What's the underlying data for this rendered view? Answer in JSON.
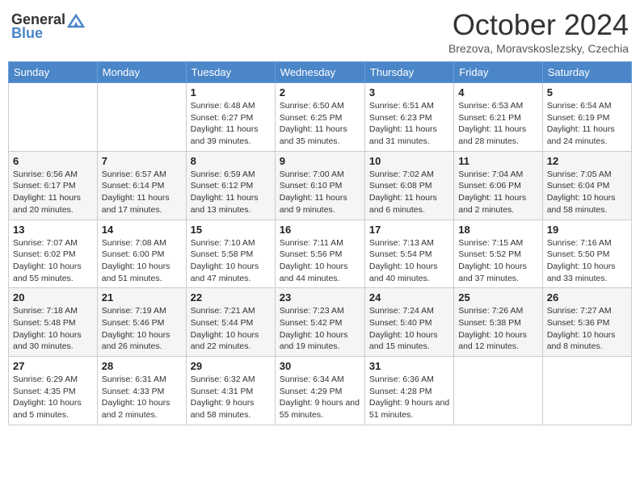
{
  "header": {
    "logo_general": "General",
    "logo_blue": "Blue",
    "month_title": "October 2024",
    "subtitle": "Brezova, Moravskoslezsky, Czechia"
  },
  "days_of_week": [
    "Sunday",
    "Monday",
    "Tuesday",
    "Wednesday",
    "Thursday",
    "Friday",
    "Saturday"
  ],
  "weeks": [
    [
      {
        "day": "",
        "sunrise": "",
        "sunset": "",
        "daylight": ""
      },
      {
        "day": "",
        "sunrise": "",
        "sunset": "",
        "daylight": ""
      },
      {
        "day": "1",
        "sunrise": "Sunrise: 6:48 AM",
        "sunset": "Sunset: 6:27 PM",
        "daylight": "Daylight: 11 hours and 39 minutes."
      },
      {
        "day": "2",
        "sunrise": "Sunrise: 6:50 AM",
        "sunset": "Sunset: 6:25 PM",
        "daylight": "Daylight: 11 hours and 35 minutes."
      },
      {
        "day": "3",
        "sunrise": "Sunrise: 6:51 AM",
        "sunset": "Sunset: 6:23 PM",
        "daylight": "Daylight: 11 hours and 31 minutes."
      },
      {
        "day": "4",
        "sunrise": "Sunrise: 6:53 AM",
        "sunset": "Sunset: 6:21 PM",
        "daylight": "Daylight: 11 hours and 28 minutes."
      },
      {
        "day": "5",
        "sunrise": "Sunrise: 6:54 AM",
        "sunset": "Sunset: 6:19 PM",
        "daylight": "Daylight: 11 hours and 24 minutes."
      }
    ],
    [
      {
        "day": "6",
        "sunrise": "Sunrise: 6:56 AM",
        "sunset": "Sunset: 6:17 PM",
        "daylight": "Daylight: 11 hours and 20 minutes."
      },
      {
        "day": "7",
        "sunrise": "Sunrise: 6:57 AM",
        "sunset": "Sunset: 6:14 PM",
        "daylight": "Daylight: 11 hours and 17 minutes."
      },
      {
        "day": "8",
        "sunrise": "Sunrise: 6:59 AM",
        "sunset": "Sunset: 6:12 PM",
        "daylight": "Daylight: 11 hours and 13 minutes."
      },
      {
        "day": "9",
        "sunrise": "Sunrise: 7:00 AM",
        "sunset": "Sunset: 6:10 PM",
        "daylight": "Daylight: 11 hours and 9 minutes."
      },
      {
        "day": "10",
        "sunrise": "Sunrise: 7:02 AM",
        "sunset": "Sunset: 6:08 PM",
        "daylight": "Daylight: 11 hours and 6 minutes."
      },
      {
        "day": "11",
        "sunrise": "Sunrise: 7:04 AM",
        "sunset": "Sunset: 6:06 PM",
        "daylight": "Daylight: 11 hours and 2 minutes."
      },
      {
        "day": "12",
        "sunrise": "Sunrise: 7:05 AM",
        "sunset": "Sunset: 6:04 PM",
        "daylight": "Daylight: 10 hours and 58 minutes."
      }
    ],
    [
      {
        "day": "13",
        "sunrise": "Sunrise: 7:07 AM",
        "sunset": "Sunset: 6:02 PM",
        "daylight": "Daylight: 10 hours and 55 minutes."
      },
      {
        "day": "14",
        "sunrise": "Sunrise: 7:08 AM",
        "sunset": "Sunset: 6:00 PM",
        "daylight": "Daylight: 10 hours and 51 minutes."
      },
      {
        "day": "15",
        "sunrise": "Sunrise: 7:10 AM",
        "sunset": "Sunset: 5:58 PM",
        "daylight": "Daylight: 10 hours and 47 minutes."
      },
      {
        "day": "16",
        "sunrise": "Sunrise: 7:11 AM",
        "sunset": "Sunset: 5:56 PM",
        "daylight": "Daylight: 10 hours and 44 minutes."
      },
      {
        "day": "17",
        "sunrise": "Sunrise: 7:13 AM",
        "sunset": "Sunset: 5:54 PM",
        "daylight": "Daylight: 10 hours and 40 minutes."
      },
      {
        "day": "18",
        "sunrise": "Sunrise: 7:15 AM",
        "sunset": "Sunset: 5:52 PM",
        "daylight": "Daylight: 10 hours and 37 minutes."
      },
      {
        "day": "19",
        "sunrise": "Sunrise: 7:16 AM",
        "sunset": "Sunset: 5:50 PM",
        "daylight": "Daylight: 10 hours and 33 minutes."
      }
    ],
    [
      {
        "day": "20",
        "sunrise": "Sunrise: 7:18 AM",
        "sunset": "Sunset: 5:48 PM",
        "daylight": "Daylight: 10 hours and 30 minutes."
      },
      {
        "day": "21",
        "sunrise": "Sunrise: 7:19 AM",
        "sunset": "Sunset: 5:46 PM",
        "daylight": "Daylight: 10 hours and 26 minutes."
      },
      {
        "day": "22",
        "sunrise": "Sunrise: 7:21 AM",
        "sunset": "Sunset: 5:44 PM",
        "daylight": "Daylight: 10 hours and 22 minutes."
      },
      {
        "day": "23",
        "sunrise": "Sunrise: 7:23 AM",
        "sunset": "Sunset: 5:42 PM",
        "daylight": "Daylight: 10 hours and 19 minutes."
      },
      {
        "day": "24",
        "sunrise": "Sunrise: 7:24 AM",
        "sunset": "Sunset: 5:40 PM",
        "daylight": "Daylight: 10 hours and 15 minutes."
      },
      {
        "day": "25",
        "sunrise": "Sunrise: 7:26 AM",
        "sunset": "Sunset: 5:38 PM",
        "daylight": "Daylight: 10 hours and 12 minutes."
      },
      {
        "day": "26",
        "sunrise": "Sunrise: 7:27 AM",
        "sunset": "Sunset: 5:36 PM",
        "daylight": "Daylight: 10 hours and 8 minutes."
      }
    ],
    [
      {
        "day": "27",
        "sunrise": "Sunrise: 6:29 AM",
        "sunset": "Sunset: 4:35 PM",
        "daylight": "Daylight: 10 hours and 5 minutes."
      },
      {
        "day": "28",
        "sunrise": "Sunrise: 6:31 AM",
        "sunset": "Sunset: 4:33 PM",
        "daylight": "Daylight: 10 hours and 2 minutes."
      },
      {
        "day": "29",
        "sunrise": "Sunrise: 6:32 AM",
        "sunset": "Sunset: 4:31 PM",
        "daylight": "Daylight: 9 hours and 58 minutes."
      },
      {
        "day": "30",
        "sunrise": "Sunrise: 6:34 AM",
        "sunset": "Sunset: 4:29 PM",
        "daylight": "Daylight: 9 hours and 55 minutes."
      },
      {
        "day": "31",
        "sunrise": "Sunrise: 6:36 AM",
        "sunset": "Sunset: 4:28 PM",
        "daylight": "Daylight: 9 hours and 51 minutes."
      },
      {
        "day": "",
        "sunrise": "",
        "sunset": "",
        "daylight": ""
      },
      {
        "day": "",
        "sunrise": "",
        "sunset": "",
        "daylight": ""
      }
    ]
  ]
}
